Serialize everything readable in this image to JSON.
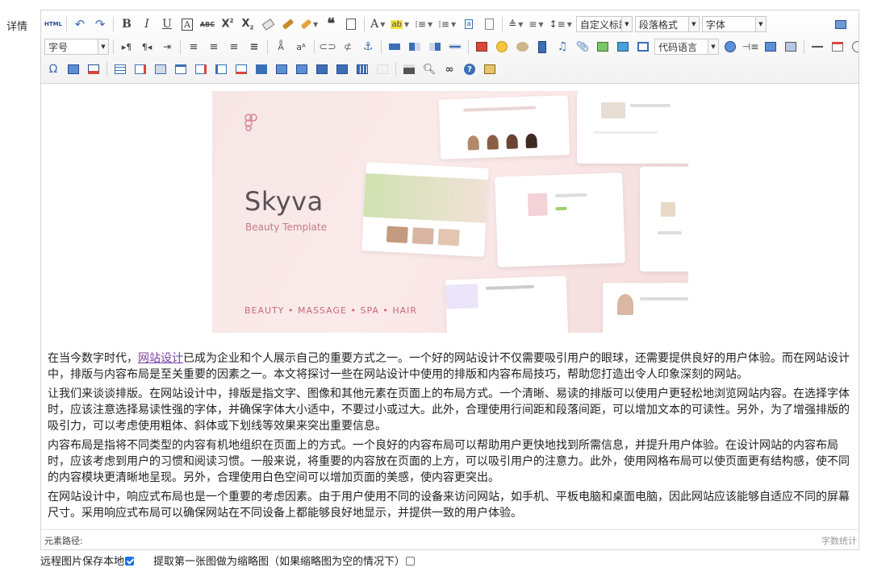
{
  "form": {
    "label": "详情",
    "option_remote_image": "远程图片保存本地",
    "option_remote_image_checked": true,
    "option_thumbnail": "提取第一张图做为缩略图（如果缩略图为空的情况下）",
    "option_thumbnail_checked": false
  },
  "toolbar": {
    "html_label": "HTML",
    "heading_select": "自定义标题",
    "paragraph_select": "段落格式",
    "font_family_select": "字体",
    "font_size_select": "字号",
    "code_language_select": "代码语言",
    "row1_icons": [
      "source-code-icon",
      "undo-icon",
      "redo-icon",
      "bold-icon",
      "italic-icon",
      "underline-icon",
      "font-border-icon",
      "strikethrough-icon",
      "superscript-icon",
      "subscript-icon",
      "remove-format-icon",
      "format-match-icon",
      "auto-typeset-icon",
      "blockquote-icon",
      "paste-plain-icon",
      "font-color-icon",
      "background-color-icon",
      "ordered-list-icon",
      "unordered-list-icon",
      "select-all-icon",
      "clear-doc-icon",
      "row-spacing-top-icon",
      "row-spacing-bottom-icon",
      "line-height-icon"
    ],
    "row2_icons": [
      "ltr-icon",
      "rtl-icon",
      "indent-icon",
      "justify-left-icon",
      "justify-center-icon",
      "justify-right-icon",
      "justify-full-icon",
      "to-uppercase-icon",
      "to-lowercase-icon",
      "link-icon",
      "unlink-icon",
      "anchor-icon",
      "image-none-icon",
      "image-left-icon",
      "image-right-icon",
      "image-center-icon",
      "simple-upload-icon",
      "emotion-icon",
      "scrawl-icon",
      "insert-video-icon",
      "music-icon",
      "attachment-icon",
      "map-icon",
      "gmap-icon",
      "insert-frame-icon",
      "insert-code-icon",
      "page-break-icon",
      "template-icon",
      "background-icon",
      "horizontal-rule-icon",
      "date-icon",
      "time-icon"
    ],
    "row3_icons": [
      "special-chars-icon",
      "wordimage-icon",
      "snapscreen-icon",
      "insert-table-icon",
      "delete-table-icon",
      "insert-paragraph-before-table-icon",
      "insert-row-icon",
      "delete-row-icon",
      "insert-col-icon",
      "delete-col-icon",
      "merge-cells-icon",
      "merge-right-icon",
      "merge-down-icon",
      "split-to-cells-icon",
      "split-to-rows-icon",
      "split-to-cols-icon",
      "charts-icon",
      "print-icon",
      "preview-icon",
      "search-replace-icon",
      "help-icon",
      "drafts-icon"
    ],
    "fullscreen_icon": "fullscreen-icon"
  },
  "hero_image": {
    "title": "Skyva",
    "subtitle": "Beauty Template",
    "tags": "BEAUTY  •  MASSAGE  •  SPA  •  HAIR",
    "accent": "#c86a78",
    "background": "#f7e6e6"
  },
  "content": {
    "p1_before_link": "在当今数字时代，",
    "p1_link": "网站设计",
    "p1_after_link": "已成为企业和个人展示自己的重要方式之一。一个好的网站设计不仅需要吸引用户的眼球，还需要提供良好的用户体验。而在网站设计中，排版与内容布局是至关重要的因素之一。本文将探讨一些在网站设计中使用的排版和内容布局技巧，帮助您打造出令人印象深刻的网站。",
    "p2": "让我们来谈谈排版。在网站设计中，排版是指文字、图像和其他元素在页面上的布局方式。一个清晰、易读的排版可以使用户更轻松地浏览网站内容。在选择字体时，应该注意选择易读性强的字体，并确保字体大小适中，不要过小或过大。此外，合理使用行间距和段落间距，可以增加文本的可读性。另外，为了增强排版的吸引力，可以考虑使用粗体、斜体或下划线等效果来突出重要信息。",
    "p3": "内容布局是指将不同类型的内容有机地组织在页面上的方式。一个良好的内容布局可以帮助用户更快地找到所需信息，并提升用户体验。在设计网站的内容布局时，应该考虑到用户的习惯和阅读习惯。一般来说，将重要的内容放在页面的上方，可以吸引用户的注意力。此外，使用网格布局可以使页面更有结构感，使不同的内容模块更清晰地呈现。另外，合理使用白色空间可以增加页面的美感，使内容更突出。",
    "p4": "在网站设计中，响应式布局也是一个重要的考虑因素。由于用户使用不同的设备来访问网站，如手机、平板电脑和桌面电脑，因此网站应该能够自适应不同的屏幕尺寸。采用响应式布局可以确保网站在不同设备上都能够良好地显示，并提供一致的用户体验。"
  },
  "statusbar": {
    "path_label": "元素路径:",
    "word_count_label": "字数统计"
  },
  "colors": {
    "link": "#7b3fa8",
    "border": "#d4d4d4",
    "toolbar_icon_blue": "#3b6fb6"
  }
}
